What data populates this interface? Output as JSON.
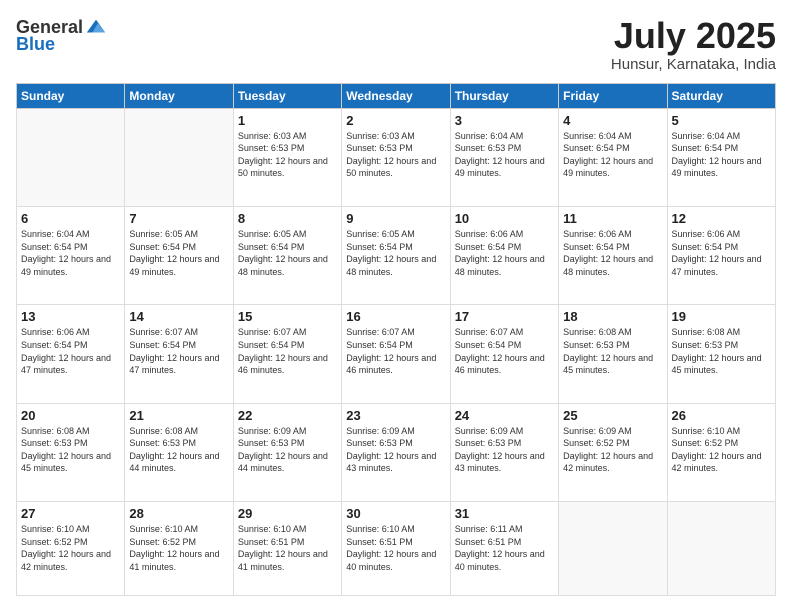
{
  "header": {
    "logo_general": "General",
    "logo_blue": "Blue",
    "month_title": "July 2025",
    "location": "Hunsur, Karnataka, India"
  },
  "weekdays": [
    "Sunday",
    "Monday",
    "Tuesday",
    "Wednesday",
    "Thursday",
    "Friday",
    "Saturday"
  ],
  "weeks": [
    [
      {
        "day": "",
        "info": ""
      },
      {
        "day": "",
        "info": ""
      },
      {
        "day": "1",
        "info": "Sunrise: 6:03 AM\nSunset: 6:53 PM\nDaylight: 12 hours and 50 minutes."
      },
      {
        "day": "2",
        "info": "Sunrise: 6:03 AM\nSunset: 6:53 PM\nDaylight: 12 hours and 50 minutes."
      },
      {
        "day": "3",
        "info": "Sunrise: 6:04 AM\nSunset: 6:53 PM\nDaylight: 12 hours and 49 minutes."
      },
      {
        "day": "4",
        "info": "Sunrise: 6:04 AM\nSunset: 6:54 PM\nDaylight: 12 hours and 49 minutes."
      },
      {
        "day": "5",
        "info": "Sunrise: 6:04 AM\nSunset: 6:54 PM\nDaylight: 12 hours and 49 minutes."
      }
    ],
    [
      {
        "day": "6",
        "info": "Sunrise: 6:04 AM\nSunset: 6:54 PM\nDaylight: 12 hours and 49 minutes."
      },
      {
        "day": "7",
        "info": "Sunrise: 6:05 AM\nSunset: 6:54 PM\nDaylight: 12 hours and 49 minutes."
      },
      {
        "day": "8",
        "info": "Sunrise: 6:05 AM\nSunset: 6:54 PM\nDaylight: 12 hours and 48 minutes."
      },
      {
        "day": "9",
        "info": "Sunrise: 6:05 AM\nSunset: 6:54 PM\nDaylight: 12 hours and 48 minutes."
      },
      {
        "day": "10",
        "info": "Sunrise: 6:06 AM\nSunset: 6:54 PM\nDaylight: 12 hours and 48 minutes."
      },
      {
        "day": "11",
        "info": "Sunrise: 6:06 AM\nSunset: 6:54 PM\nDaylight: 12 hours and 48 minutes."
      },
      {
        "day": "12",
        "info": "Sunrise: 6:06 AM\nSunset: 6:54 PM\nDaylight: 12 hours and 47 minutes."
      }
    ],
    [
      {
        "day": "13",
        "info": "Sunrise: 6:06 AM\nSunset: 6:54 PM\nDaylight: 12 hours and 47 minutes."
      },
      {
        "day": "14",
        "info": "Sunrise: 6:07 AM\nSunset: 6:54 PM\nDaylight: 12 hours and 47 minutes."
      },
      {
        "day": "15",
        "info": "Sunrise: 6:07 AM\nSunset: 6:54 PM\nDaylight: 12 hours and 46 minutes."
      },
      {
        "day": "16",
        "info": "Sunrise: 6:07 AM\nSunset: 6:54 PM\nDaylight: 12 hours and 46 minutes."
      },
      {
        "day": "17",
        "info": "Sunrise: 6:07 AM\nSunset: 6:54 PM\nDaylight: 12 hours and 46 minutes."
      },
      {
        "day": "18",
        "info": "Sunrise: 6:08 AM\nSunset: 6:53 PM\nDaylight: 12 hours and 45 minutes."
      },
      {
        "day": "19",
        "info": "Sunrise: 6:08 AM\nSunset: 6:53 PM\nDaylight: 12 hours and 45 minutes."
      }
    ],
    [
      {
        "day": "20",
        "info": "Sunrise: 6:08 AM\nSunset: 6:53 PM\nDaylight: 12 hours and 45 minutes."
      },
      {
        "day": "21",
        "info": "Sunrise: 6:08 AM\nSunset: 6:53 PM\nDaylight: 12 hours and 44 minutes."
      },
      {
        "day": "22",
        "info": "Sunrise: 6:09 AM\nSunset: 6:53 PM\nDaylight: 12 hours and 44 minutes."
      },
      {
        "day": "23",
        "info": "Sunrise: 6:09 AM\nSunset: 6:53 PM\nDaylight: 12 hours and 43 minutes."
      },
      {
        "day": "24",
        "info": "Sunrise: 6:09 AM\nSunset: 6:53 PM\nDaylight: 12 hours and 43 minutes."
      },
      {
        "day": "25",
        "info": "Sunrise: 6:09 AM\nSunset: 6:52 PM\nDaylight: 12 hours and 42 minutes."
      },
      {
        "day": "26",
        "info": "Sunrise: 6:10 AM\nSunset: 6:52 PM\nDaylight: 12 hours and 42 minutes."
      }
    ],
    [
      {
        "day": "27",
        "info": "Sunrise: 6:10 AM\nSunset: 6:52 PM\nDaylight: 12 hours and 42 minutes."
      },
      {
        "day": "28",
        "info": "Sunrise: 6:10 AM\nSunset: 6:52 PM\nDaylight: 12 hours and 41 minutes."
      },
      {
        "day": "29",
        "info": "Sunrise: 6:10 AM\nSunset: 6:51 PM\nDaylight: 12 hours and 41 minutes."
      },
      {
        "day": "30",
        "info": "Sunrise: 6:10 AM\nSunset: 6:51 PM\nDaylight: 12 hours and 40 minutes."
      },
      {
        "day": "31",
        "info": "Sunrise: 6:11 AM\nSunset: 6:51 PM\nDaylight: 12 hours and 40 minutes."
      },
      {
        "day": "",
        "info": ""
      },
      {
        "day": "",
        "info": ""
      }
    ]
  ]
}
